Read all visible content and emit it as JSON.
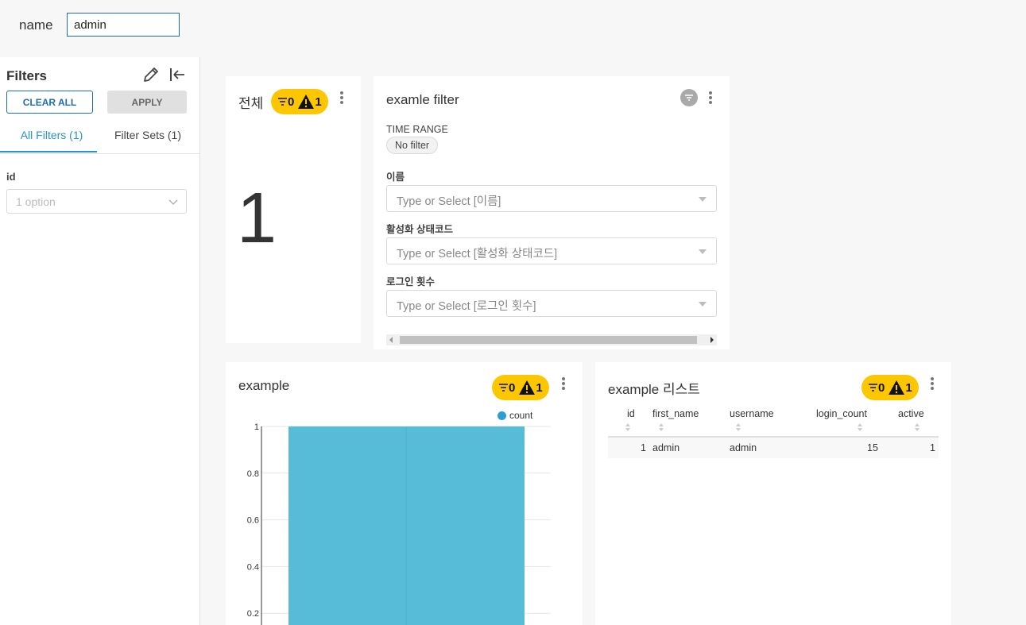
{
  "header": {
    "name_label": "name",
    "name_value": "admin"
  },
  "sidebar": {
    "title": "Filters",
    "clear_all": "CLEAR ALL",
    "apply": "APPLY",
    "tabs": [
      {
        "label": "All Filters (1)"
      },
      {
        "label": "Filter Sets (1)"
      }
    ],
    "filter": {
      "label": "id",
      "placeholder": "1 option"
    }
  },
  "cards": {
    "total": {
      "title": "전체",
      "badge_filters": "0",
      "badge_warnings": "1",
      "value": "1"
    },
    "filter_box": {
      "title": "examle filter",
      "time_range_label": "TIME RANGE",
      "no_filter": "No filter",
      "fields": [
        {
          "label": "이름",
          "placeholder": "Type or Select [이름]"
        },
        {
          "label": "활성화 상태코드",
          "placeholder": "Type or Select [활성화 상태코드]"
        },
        {
          "label": "로그인 횟수",
          "placeholder": "Type or Select [로그인 횟수]"
        }
      ]
    },
    "example": {
      "title": "example",
      "badge_filters": "0",
      "badge_warnings": "1"
    },
    "example_list": {
      "title": "example 리스트",
      "badge_filters": "0",
      "badge_warnings": "1",
      "columns": [
        "id",
        "first_name",
        "username",
        "login_count",
        "active"
      ],
      "rows": [
        {
          "id": "1",
          "first_name": "admin",
          "username": "admin",
          "login_count": "15",
          "active": "1"
        }
      ]
    }
  },
  "chart_data": {
    "type": "bar",
    "categories": [
      ""
    ],
    "series": [
      {
        "name": "count",
        "values": [
          1
        ],
        "color": "#57bcd8"
      }
    ],
    "yticks": [
      "1",
      "0.8",
      "0.6",
      "0.4",
      "0.2"
    ],
    "ylim": [
      0,
      1
    ],
    "legend": "top-right"
  }
}
